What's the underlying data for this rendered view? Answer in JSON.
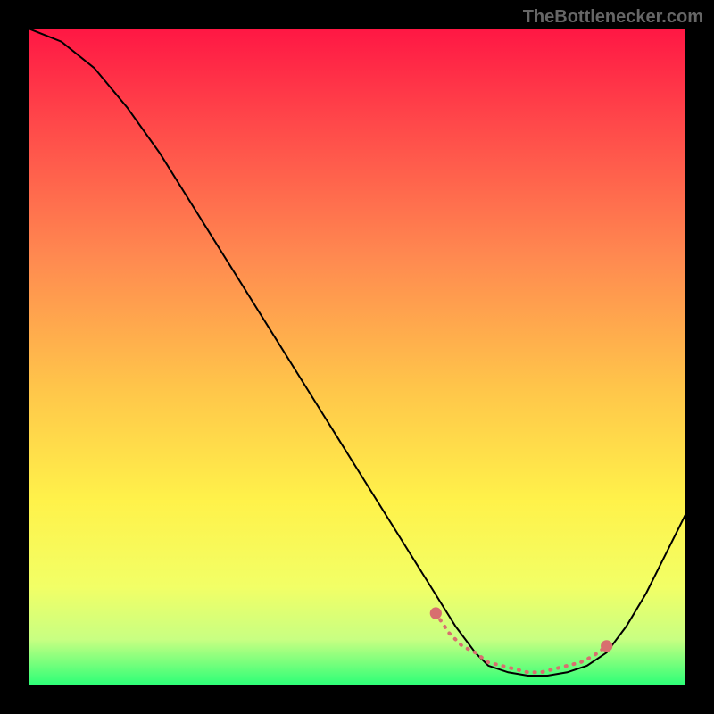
{
  "watermark": "TheBottlenecker.com",
  "chart_data": {
    "type": "line",
    "title": "",
    "xlabel": "",
    "ylabel": "",
    "xlim": [
      0,
      100
    ],
    "ylim": [
      0,
      100
    ],
    "series": [
      {
        "name": "bottleneck-curve",
        "color": "#000000",
        "x": [
          0,
          5,
          10,
          15,
          20,
          25,
          30,
          35,
          40,
          45,
          50,
          55,
          60,
          65,
          68,
          70,
          73,
          76,
          79,
          82,
          85,
          88,
          91,
          94,
          97,
          100
        ],
        "y": [
          100,
          98,
          94,
          88,
          81,
          73,
          65,
          57,
          49,
          41,
          33,
          25,
          17,
          9,
          5,
          3,
          2,
          1.5,
          1.5,
          2,
          3,
          5,
          9,
          14,
          20,
          26
        ]
      }
    ],
    "highlight_segment": {
      "name": "optimal-range-beads",
      "color": "#d86f6f",
      "x": [
        62,
        64,
        66,
        68,
        70,
        72,
        74,
        76,
        78,
        80,
        82,
        84,
        86,
        88
      ],
      "y": [
        11,
        8,
        6,
        5,
        3.5,
        3,
        2.5,
        2,
        2,
        2.5,
        3,
        3.5,
        4.5,
        6
      ]
    },
    "background_gradient": {
      "stops": [
        {
          "offset": 0.0,
          "color": "#ff1744"
        },
        {
          "offset": 0.15,
          "color": "#ff4a4a"
        },
        {
          "offset": 0.35,
          "color": "#ff8a50"
        },
        {
          "offset": 0.55,
          "color": "#ffc64a"
        },
        {
          "offset": 0.72,
          "color": "#fff24a"
        },
        {
          "offset": 0.85,
          "color": "#f2ff66"
        },
        {
          "offset": 0.93,
          "color": "#c8ff82"
        },
        {
          "offset": 1.0,
          "color": "#2bff77"
        }
      ]
    }
  }
}
